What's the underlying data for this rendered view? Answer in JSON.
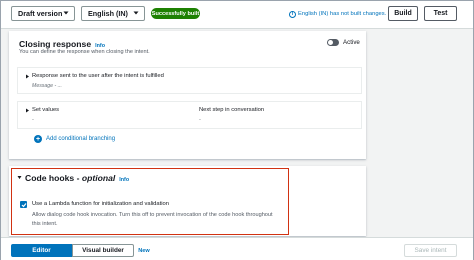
{
  "toolbar": {
    "version_select": "Draft version",
    "language_select": "English (IN)",
    "build_status": "Successfully built",
    "build_notice": "English (IN) has not built changes.",
    "build_button": "Build",
    "test_button": "Test"
  },
  "closing_response": {
    "title": "Closing response",
    "info": "Info",
    "description": "You can define the response when closing the intent.",
    "toggle_label": "Active",
    "toggle_on": true,
    "response_label": "Response sent to the user after the intent is fulfilled",
    "message_placeholder": "Message - ...",
    "set_values_label": "Set values",
    "next_step_label": "Next step in conversation",
    "set_values_value": "-",
    "next_step_value": "-",
    "add_branching": "Add conditional branching"
  },
  "code_hooks": {
    "title": "Code hooks - ",
    "title_italic": "optional",
    "info": "Info",
    "checkbox_label": "Use a Lambda function for initialization and validation",
    "checkbox_checked": true,
    "checkbox_description": "Allow dialog code hook invocation. Turn this off to prevent invocation of the code hook throughout this intent."
  },
  "bottom": {
    "editor_tab": "Editor",
    "visual_builder_tab": "Visual builder",
    "new_badge": "New",
    "save_button": "Save intent"
  },
  "colors": {
    "accent": "#0073bb",
    "success": "#1d8102",
    "highlight": "#d13212"
  }
}
